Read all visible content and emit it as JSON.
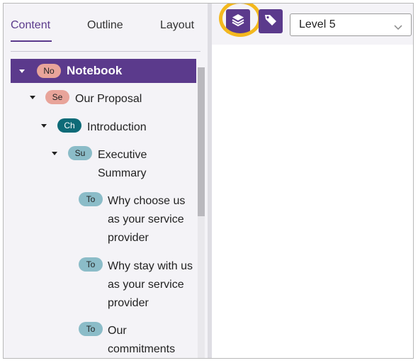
{
  "tabs": [
    "Content",
    "Outline",
    "Layout"
  ],
  "tree": {
    "root": {
      "badge": "No",
      "label": "Notebook"
    },
    "section": {
      "badge": "Se",
      "label": "Our Proposal"
    },
    "chapter": {
      "badge": "Ch",
      "label": "Introduction"
    },
    "subsection": {
      "badge": "Su",
      "label_line1": "Executive",
      "label_line2": "Summary"
    },
    "topics": [
      {
        "badge": "To",
        "lines": [
          "Why choose us",
          "as your service",
          "provider"
        ]
      },
      {
        "badge": "To",
        "lines": [
          "Why stay with us",
          "as your service",
          "provider"
        ]
      },
      {
        "badge": "To",
        "lines": [
          "Our",
          "commitments"
        ]
      }
    ]
  },
  "toolbar": {
    "layers_icon": "layers-icon",
    "tag_icon": "tag-icon",
    "level_select": "Level 5"
  },
  "colors": {
    "accent": "#5b3a8c",
    "highlight": "#f3b81e",
    "badge_no": "#e8a49a",
    "badge_se": "#e8a49a",
    "badge_ch": "#0e6b78",
    "badge_su": "#8bbcc8",
    "badge_to": "#8bbcc8"
  }
}
